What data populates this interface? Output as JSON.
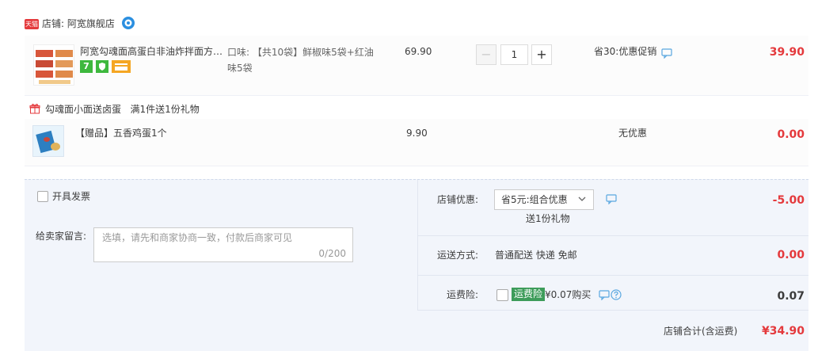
{
  "shop": {
    "badge": "天猫",
    "label": "店铺: 阿宽旗舰店",
    "chat_icon": "wangwang-chat-icon"
  },
  "item": {
    "title": "阿宽勾魂面高蛋白非油炸拌面方便面",
    "sku": "口味: 【共10袋】鲜椒味5袋+红油味5袋",
    "price": "69.90",
    "quantity": "1",
    "minus_label": "−",
    "plus_label": "+",
    "promo": "省30:优惠促销",
    "total": "39.90",
    "badges": [
      "7",
      "shield-icon",
      "card-icon"
    ],
    "badge_colors": [
      "#3eb83e",
      "#3eb83e",
      "#f5a623"
    ]
  },
  "gift": {
    "title": "勾魂面小面送卤蛋   满1件送1份礼物",
    "name": "【赠品】五香鸡蛋1个",
    "price": "9.90",
    "promo": "无优惠",
    "total": "0.00"
  },
  "order": {
    "invoice_label": "开具发票",
    "message_label": "给卖家留言:",
    "message_placeholder": "选填，请先和商家协商一致，付款后商家可见",
    "message_count": "0/200",
    "shop_discount_label": "店铺优惠:",
    "shop_discount_value": "省5元:组合优惠",
    "gift_note": "送1份礼物",
    "shop_discount_amount": "-5.00",
    "shipping_label": "运送方式:",
    "shipping_value": "普通配送 快递 免邮",
    "shipping_amount": "0.00",
    "insurance_label": "运费险:",
    "insurance_tag": "运费险",
    "insurance_price": "¥0.07购买",
    "insurance_amount": "0.07",
    "grand_total_label": "店铺合计(含运费)",
    "grand_total_amount": "¥34.90"
  },
  "colors": {
    "accent_red": "#e4393c",
    "section_bg": "#f2f5fb",
    "insurance_green": "#3d9c5a",
    "link_blue": "#5aa7e0"
  }
}
